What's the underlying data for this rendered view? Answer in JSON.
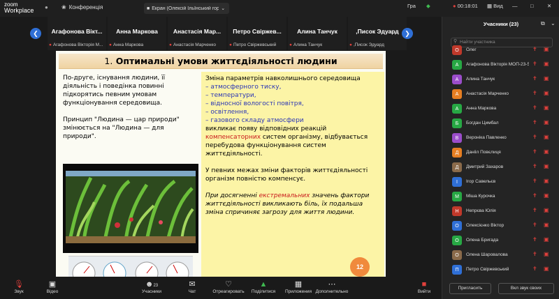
{
  "window": {
    "brand_line1": "zoom",
    "brand_line2": "Workplace",
    "meeting_label": "Конференція",
    "share_label": "Екран (Олексій Ільїнський гор",
    "timer": "00:18:01",
    "view_label": "Вид",
    "grid_label": "Гра"
  },
  "gallery": [
    {
      "name": "Агафонова  Вікт...",
      "sub": "Агафонова Вікторія М..."
    },
    {
      "name": "Анна Маркова",
      "sub": "Анна Маркова"
    },
    {
      "name": "Анастасія  Мар...",
      "sub": "Анастасія Марченко"
    },
    {
      "name": "Петро  Свіржев...",
      "sub": "Петро Свіржевський"
    },
    {
      "name": "Алина Танчук",
      "sub": "Алина Танчук"
    },
    {
      "name": ",Писок Эдуард",
      "sub": ",Писок Эдуард"
    }
  ],
  "slide": {
    "number": "1.",
    "title": "Оптимальні умови життєдіяльності людини",
    "left_p1": "По-друге, існування людини, її діяльність і поведінка повинні підкорятись певним умовам функціонування середовища.",
    "left_p2": "Принцип \"Людина — цар природи\" змінюється на \"Людина — для природи\".",
    "right_intro": "Зміна параметрів навколишнього середовища",
    "right_items": [
      "– атмосферного тиску,",
      "– температури,",
      "– відносної вологості повітря,",
      "– освітлення,",
      "– газового складу атмосфери"
    ],
    "right_p1_a": " викликає появу відповідних реакцій ",
    "right_p1_red": "компенсаторних",
    "right_p1_b": " систем організму, відбувається перебудова функціонування систем життєдіяльності.",
    "right_p2": "У певних межах зміни факторів життєдіяльності організм повністю компенсує.",
    "right_p3_a": "При досягненні ",
    "right_p3_red": "екстремальних",
    "right_p3_b": " значень фактори життєдіяльності викликають біль, їх подальша зміна спричиняє загрозу для життя людини.",
    "page": "12"
  },
  "toolbar": {
    "audio": "Звук",
    "video": "Відео",
    "participants": "Учасники",
    "participants_count": "23",
    "chat": "Чат",
    "react": "Отреагировать",
    "share": "Поділитися",
    "apps": "Приложения",
    "more": "Дополнительно",
    "leave": "Вийти"
  },
  "panel": {
    "title": "Учасники (23)",
    "search_placeholder": "Найти участника",
    "invite": "Пригласить",
    "mute_all": "Вкл звук своих",
    "participants": [
      {
        "initial": "О",
        "name": "Олег",
        "color": "#c0392b"
      },
      {
        "initial": "А",
        "name": "Агафонова Вікторія МОП-23-5...",
        "color": "#27a844"
      },
      {
        "initial": "А",
        "name": "Алина Танчук",
        "color": "#9b4dca"
      },
      {
        "initial": "А",
        "name": "Анастасія Марченко",
        "color": "#e67e22"
      },
      {
        "initial": "А",
        "name": "Анна Маркова",
        "color": "#27a844"
      },
      {
        "initial": "Б",
        "name": "Богдан Цимбал",
        "color": "#27a844"
      },
      {
        "initial": "В",
        "name": "Вероніка Павленко",
        "color": "#9b4dca"
      },
      {
        "initial": "Д",
        "name": "Данііл Повєлиця",
        "color": "#e67e22"
      },
      {
        "initial": "Д",
        "name": "Дмитрий Захаров",
        "color": "#8a6a4a"
      },
      {
        "initial": "І",
        "name": "Ігор Савельєв",
        "color": "#2f6fd6"
      },
      {
        "initial": "М",
        "name": "Міша Курочка",
        "color": "#27a844"
      },
      {
        "initial": "Н",
        "name": "Непрєва Юлія",
        "color": "#c0392b"
      },
      {
        "initial": "О",
        "name": "Олексієнко Віктор",
        "color": "#2f6fd6"
      },
      {
        "initial": "О",
        "name": "Олена Бригада",
        "color": "#27a844"
      },
      {
        "initial": "О",
        "name": "Олена Шаровалова",
        "color": "#8a6a4a"
      },
      {
        "initial": "П",
        "name": "Петро Свіржевський",
        "color": "#2f6fd6"
      }
    ]
  }
}
